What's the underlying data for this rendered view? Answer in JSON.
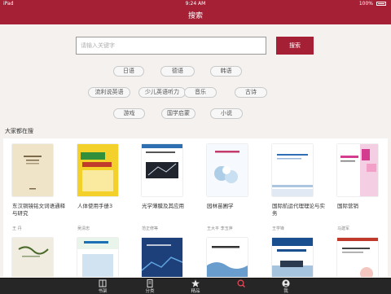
{
  "status_bar": {
    "carrier": "iPad",
    "time": "9:24 AM",
    "battery": "100%"
  },
  "nav": {
    "title": "搜索"
  },
  "search": {
    "placeholder": "请输入关键字",
    "value": "",
    "button": "搜索"
  },
  "tags": [
    "日语",
    "德语",
    "韩语",
    "流利说英语",
    "少儿英语听力",
    "音乐",
    "古诗",
    "游戏",
    "国学启蒙",
    "小说"
  ],
  "section_title": "大家都在搜",
  "books": [
    {
      "title": "东汉铜镜铭文词语通释与研究",
      "author": "王  丹"
    },
    {
      "title": "人体使用手册3",
      "author": "吴清忠"
    },
    {
      "title": "光学薄膜及其应用",
      "author": "范正修等"
    },
    {
      "title": "园林苗圃学",
      "author": "王大平 李玉萍"
    },
    {
      "title": "国际航运代理理论与实务",
      "author": "王学锋"
    },
    {
      "title": "国际营销",
      "author": "马建军"
    },
    {
      "title": "",
      "author": ""
    },
    {
      "title": "",
      "author": ""
    },
    {
      "title": "",
      "author": ""
    },
    {
      "title": "",
      "author": ""
    },
    {
      "title": "",
      "author": ""
    },
    {
      "title": "",
      "author": ""
    }
  ],
  "covers": [
    {
      "bg": "#efe3c8",
      "accent": "#7c6a4a",
      "style": "plain"
    },
    {
      "bg": "#f4d12a",
      "accent": "#2f8f3a",
      "style": "bold"
    },
    {
      "bg": "#ffffff",
      "accent": "#2d6fb0",
      "style": "dark-panel"
    },
    {
      "bg": "#ffffff",
      "accent": "#7eb0d8",
      "style": "flower"
    },
    {
      "bg": "#ffffff",
      "accent": "#2f6eb5",
      "style": "lines"
    },
    {
      "bg": "#ffffff",
      "accent": "#d43d8f",
      "style": "blocks"
    },
    {
      "bg": "#f1ece0",
      "accent": "#4b6b2c",
      "style": "script"
    },
    {
      "bg": "#ffffff",
      "accent": "#1a6fb5",
      "style": "green-top"
    },
    {
      "bg": "#1d3f7a",
      "accent": "#5fa4e0",
      "style": "dark"
    },
    {
      "bg": "#ffffff",
      "accent": "#2a74b8",
      "style": "wave"
    },
    {
      "bg": "#ffffff",
      "accent": "#1a4f8f",
      "style": "ship"
    },
    {
      "bg": "#ffffff",
      "accent": "#c0392b",
      "style": "red-bar"
    }
  ],
  "tabbar": {
    "active_color": "#e94b5a",
    "items": [
      {
        "label": "书架",
        "icon": "bookshelf-icon"
      },
      {
        "label": "分类",
        "icon": "category-icon"
      },
      {
        "label": "精品",
        "icon": "star-icon"
      },
      {
        "label": "",
        "icon": "search-icon"
      },
      {
        "label": "我",
        "icon": "person-icon"
      }
    ]
  }
}
